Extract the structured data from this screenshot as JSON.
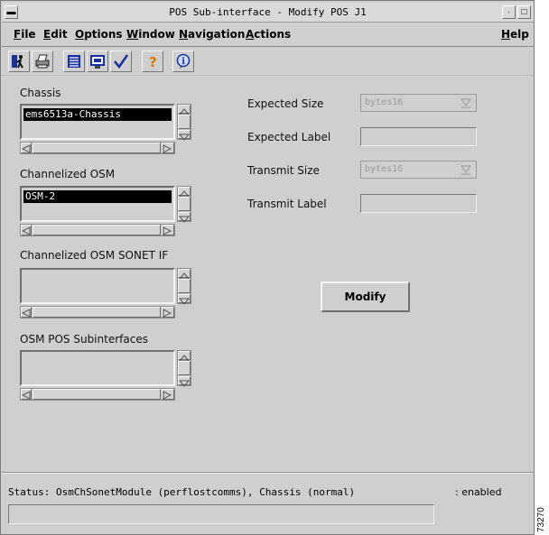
{
  "window": {
    "title": "POS Sub-interface - Modify POS J1"
  },
  "menu": [
    {
      "mnemonic": "F",
      "rest": "ile"
    },
    {
      "mnemonic": "E",
      "rest": "dit"
    },
    {
      "mnemonic": "O",
      "rest": "ptions"
    },
    {
      "mnemonic": "W",
      "rest": "indow"
    },
    {
      "mnemonic": "N",
      "rest": "avigation"
    },
    {
      "mnemonic": "A",
      "rest": "ctions"
    },
    {
      "mnemonic": "H",
      "rest": "elp"
    }
  ],
  "toolbar": {
    "icons": [
      "exit-icon",
      "print-icon",
      "list-icon",
      "screen-icon",
      "check-icon",
      "help-icon",
      "info-icon"
    ]
  },
  "lists": {
    "chassis": {
      "label": "Chassis",
      "selected": "ems6513a-Chassis"
    },
    "osm": {
      "label": "Channelized OSM",
      "selected": "OSM-2"
    },
    "sonet": {
      "label": "Channelized OSM SONET IF",
      "selected": ""
    },
    "subinterfaces": {
      "label": "OSM POS Subinterfaces",
      "selected": ""
    }
  },
  "form": {
    "expected_size_label": "Expected Size",
    "expected_size_value": "bytes16",
    "expected_label_label": "Expected Label",
    "expected_label_value": "",
    "transmit_size_label": "Transmit Size",
    "transmit_size_value": "bytes16",
    "transmit_label_label": "Transmit Label",
    "transmit_label_value": ""
  },
  "modify_button": "Modify",
  "status": {
    "text": "Status: OsmChSonetModule (perflostcomms), Chassis (normal)",
    "right": ": enabled"
  },
  "figure_id": "73270",
  "colors": {
    "background": "#cfcfcf",
    "selection": "#000000"
  }
}
